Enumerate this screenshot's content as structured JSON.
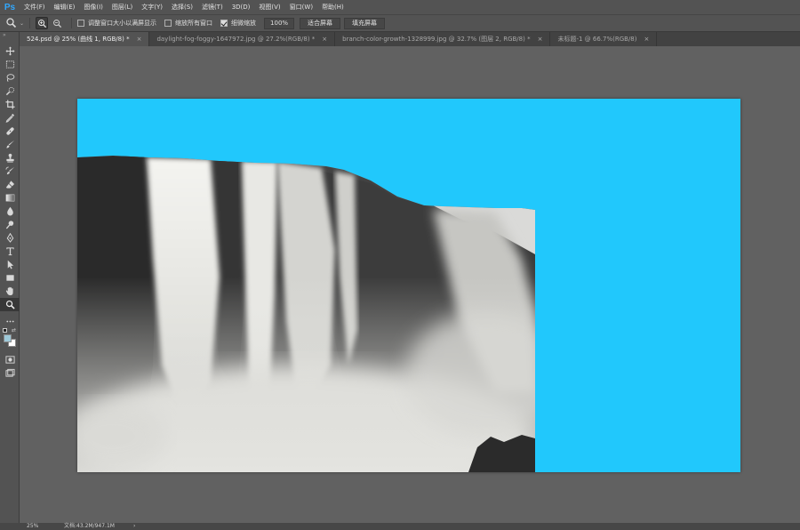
{
  "app": {
    "logo": "Ps"
  },
  "menu": [
    "文件(F)",
    "编辑(E)",
    "图像(I)",
    "图层(L)",
    "文字(Y)",
    "选择(S)",
    "滤镜(T)",
    "3D(D)",
    "视图(V)",
    "窗口(W)",
    "帮助(H)"
  ],
  "options": {
    "resize_windows_label": "调整窗口大小以满屏显示",
    "zoom_all_windows_label": "缩放所有窗口",
    "scrubby_zoom_label": "细微缩放",
    "zoom_percent": "100%",
    "fit_screen_button": "适合屏幕",
    "fill_screen_button": "填充屏幕",
    "resize_windows_checked": false,
    "zoom_all_windows_checked": false,
    "scrubby_zoom_checked": true
  },
  "tabs": [
    {
      "label": "524.psd @ 25% (曲线 1, RGB/8) *",
      "active": true
    },
    {
      "label": "daylight-fog-foggy-1647972.jpg @ 27.2%(RGB/8) *",
      "active": false
    },
    {
      "label": "branch-color-growth-1328999.jpg @ 32.7% (图层 2, RGB/8) *",
      "active": false
    },
    {
      "label": "未标题-1 @ 66.7%(RGB/8)",
      "active": false
    }
  ],
  "tab_close_glyph": "×",
  "colors": {
    "canvas_background": "#21c8fc",
    "foreground_swatch": "#9ec9d9",
    "background_swatch": "#ffffff"
  },
  "status": {
    "zoom": "25%",
    "doc_info": "文档:43.2M/947.1M",
    "arrow": "›"
  }
}
